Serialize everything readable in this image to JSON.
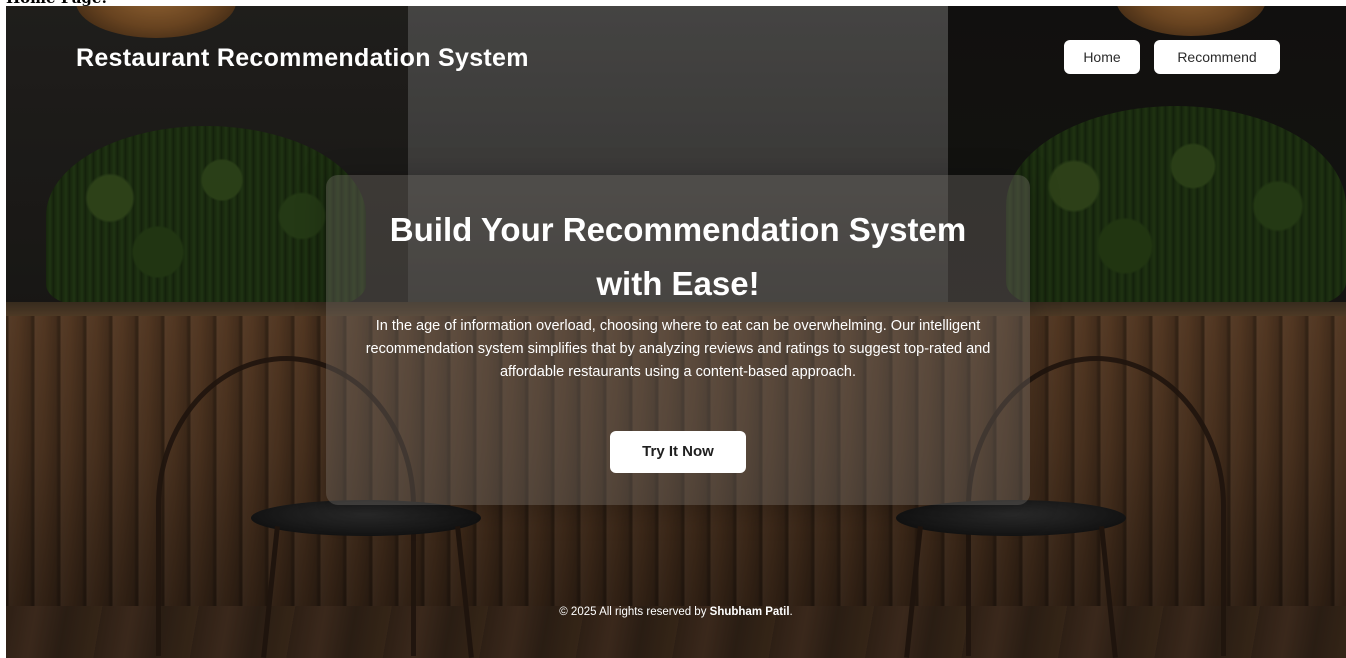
{
  "caption": "Home Page:",
  "header": {
    "brand": "Restaurant Recommendation System",
    "nav": [
      {
        "label": "Home"
      },
      {
        "label": "Recommend"
      }
    ]
  },
  "hero": {
    "title": "Build Your Recommendation System with Ease!",
    "description": "In the age of information overload, choosing where to eat can be overwhelming. Our intelligent recommendation system simplifies that by analyzing reviews and ratings to suggest top-rated and affordable restaurants using a content-based approach.",
    "cta_label": "Try It Now"
  },
  "footer": {
    "prefix": "© 2025 All rights reserved by",
    "author": "Shubham Patil",
    "suffix": "."
  },
  "colors": {
    "card_background": "rgba(110,105,100,0.40)",
    "button_background": "#ffffff",
    "text_light": "#ffffff"
  }
}
